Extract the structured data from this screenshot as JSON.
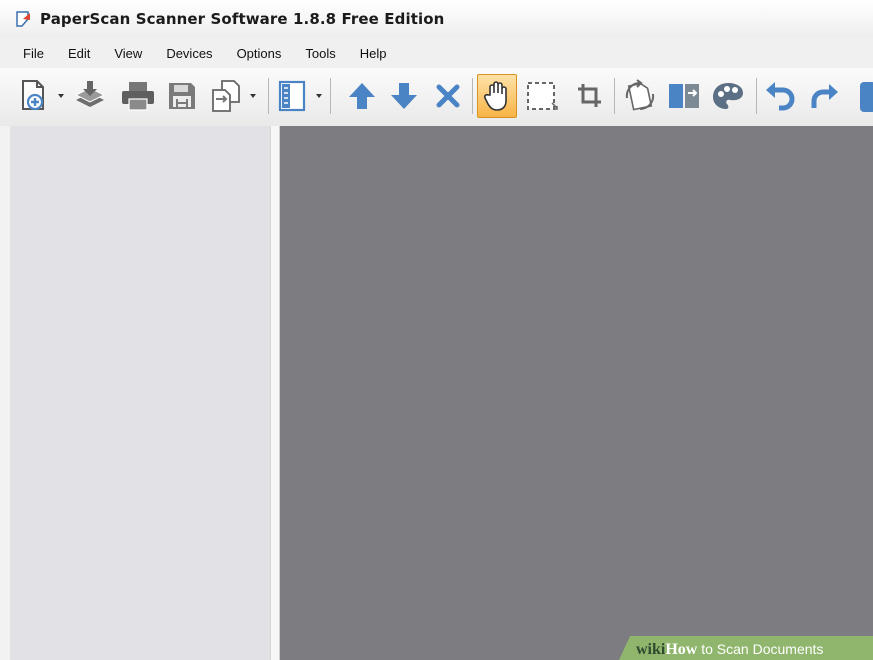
{
  "window": {
    "title": "PaperScan Scanner Software 1.8.8 Free Edition",
    "app_icon": "paperscan-logo-icon"
  },
  "menu": {
    "items": [
      "File",
      "Edit",
      "View",
      "Devices",
      "Options",
      "Tools",
      "Help"
    ]
  },
  "toolbar": {
    "buttons": [
      {
        "icon": "new-document-icon",
        "dropdown": true
      },
      {
        "icon": "scan-stack-icon"
      },
      {
        "icon": "print-icon"
      },
      {
        "icon": "save-icon"
      },
      {
        "icon": "export-pages-icon",
        "dropdown": true
      },
      {
        "icon": "panel-layout-icon",
        "dropdown": true
      },
      {
        "icon": "arrow-up-icon"
      },
      {
        "icon": "arrow-down-icon"
      },
      {
        "icon": "delete-icon"
      },
      {
        "icon": "hand-pan-icon",
        "active": true
      },
      {
        "icon": "selection-icon"
      },
      {
        "icon": "crop-icon"
      },
      {
        "icon": "rotate-icon"
      },
      {
        "icon": "flip-icon"
      },
      {
        "icon": "color-palette-icon"
      },
      {
        "icon": "undo-icon"
      },
      {
        "icon": "redo-icon"
      }
    ],
    "accent_active": "#f8b446",
    "icon_color": "#4b84c4"
  },
  "watermark": {
    "wiki": "wiki",
    "how": "How",
    "text": "to Scan Documents"
  },
  "colors": {
    "viewer_bg": "#7d7c80",
    "thumbnail_bg": "#e2e1e5"
  }
}
